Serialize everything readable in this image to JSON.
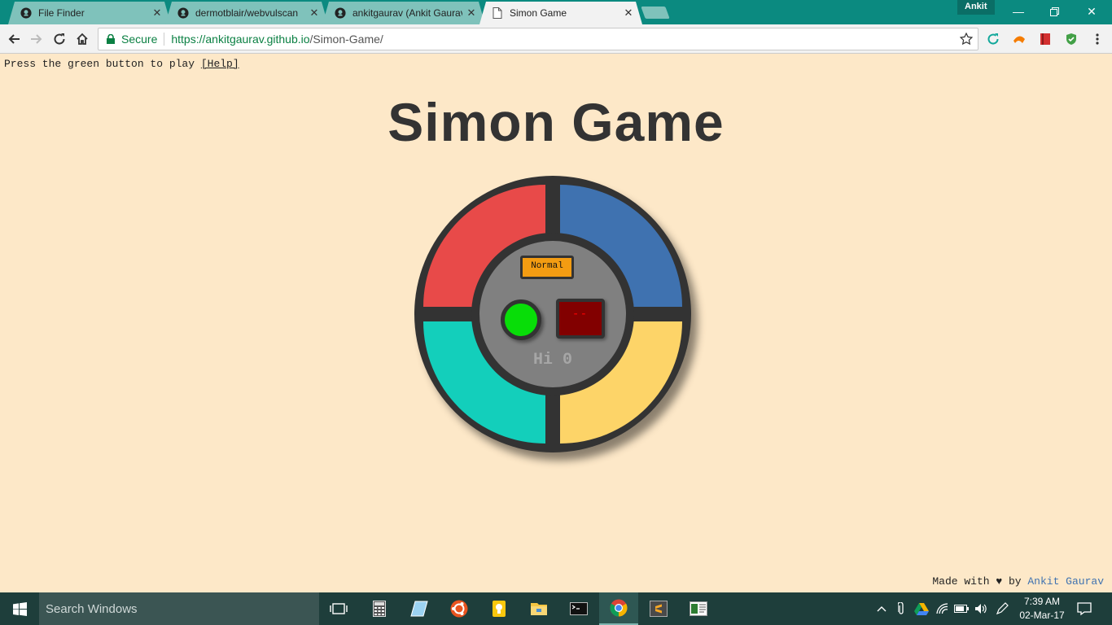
{
  "browser": {
    "tabs": [
      {
        "title": "File Finder",
        "icon": "github-icon",
        "active": false
      },
      {
        "title": "dermotblair/webvulscan",
        "icon": "github-icon",
        "active": false
      },
      {
        "title": "ankitgaurav (Ankit Gaurav)",
        "icon": "github-icon",
        "active": false
      },
      {
        "title": "Simon Game",
        "icon": "page-icon",
        "active": true
      }
    ],
    "profile_name": "Ankit",
    "security_label": "Secure",
    "url_host": "https://ankitgaurav.github.io",
    "url_path": "/Simon-Game/"
  },
  "page": {
    "instruction_text": "Press the green button to play ",
    "help_link": "[Help]",
    "title": "Simon Game",
    "mode_button": "Normal",
    "display_text": "--",
    "hiscore_label": "Hi 0",
    "credit_prefix": "Made with ♥ by ",
    "credit_author": "Ankit Gaurav"
  },
  "colors": {
    "background": "#fde8c8",
    "red_pad": "#e84a49",
    "blue_pad": "#3f72b0",
    "teal_pad": "#13cfbb",
    "yellow_pad": "#fdd468",
    "start_button": "#08dd08",
    "mode_button": "#f39c12",
    "display_bg": "#820000"
  },
  "taskbar": {
    "search_placeholder": "Search Windows",
    "apps": [
      "task-view-icon",
      "calculator-icon",
      "notes-icon",
      "ubuntu-icon",
      "lightbulb-icon",
      "file-explorer-icon",
      "terminal-icon",
      "chrome-icon",
      "sublime-icon",
      "presentation-icon"
    ],
    "time": "7:39 AM",
    "date": "02-Mar-17"
  }
}
